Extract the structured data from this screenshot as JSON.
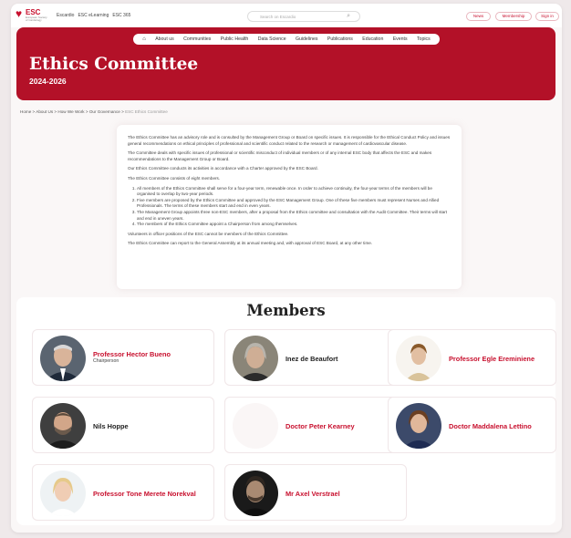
{
  "header": {
    "logo_text": "ESC",
    "logo_sub": "European Society of Cardiology",
    "links": [
      "Escardio",
      "ESC eLearning",
      "ESC 365"
    ],
    "search_placeholder": "Search on Escardio",
    "buttons": [
      "News",
      "Membership",
      "Sign in"
    ]
  },
  "nav": [
    "About us",
    "Communities",
    "Public Health",
    "Data Science",
    "Guidelines",
    "Publications",
    "Education",
    "Events",
    "Topics"
  ],
  "hero": {
    "title": "Ethics Committee",
    "years": "2024-2026"
  },
  "breadcrumb": [
    "Home",
    "About Us",
    "How We Work",
    "Our Governance",
    "ESC Ethics Committee"
  ],
  "content": {
    "p1": "The Ethics Committee has an advisory role and is consulted by the Management Group or Board on specific issues. It is responsible for the Ethical Conduct Policy and issues general recommendations on ethical principles of professional and scientific conduct related to the research or management of cardiovascular disease.",
    "p2": "The Committee deals with specific issues of professional or scientific misconduct of individual members or of any internal ESC body that affects the ESC and makes recommendations to the Management Group or Board.",
    "p3": "Our Ethics Committee conducts its activities in accordance with a Charter approved by the ESC Board.",
    "p4": "The Ethics Committee consists of eight members.",
    "list": [
      "All members of the Ethics Committee shall serve for a four-year term, renewable once. In order to achieve continuity, the four-year terms of the members will be organised to overlap by two-year periods.",
      "Five members are proposed by the Ethics Committee and approved by the ESC Management Group. One of these five members must represent Nurses and Allied Professionals. The terms of these members start and end in even years.",
      "The Management Group appoints three non-ESC members, after a proposal from the Ethics committee and consultation with the Audit Committee. Their terms will start and end in uneven years.",
      "The members of the Ethics Committee appoint a Chairperson from among themselves."
    ],
    "p5": "Volunteers in officer positions of the ESC cannot be members of the Ethics Committee.",
    "p6": "The Ethics Committee can report to the General Assembly at its annual meeting and, with approval of ESC Board, at any other time."
  },
  "members": {
    "title": "Members",
    "items": [
      {
        "name": "Professor Hector Bueno",
        "role": "Chairperson",
        "name_color": "red"
      },
      {
        "name": "Inez de Beaufort",
        "role": "",
        "name_color": "black"
      },
      {
        "name": "Professor Egle Ereminiene",
        "role": "",
        "name_color": "red"
      },
      {
        "name": "Nils Hoppe",
        "role": "",
        "name_color": "black"
      },
      {
        "name": "Doctor Peter Kearney",
        "role": "",
        "name_color": "red"
      },
      {
        "name": "Doctor Maddalena Lettino",
        "role": "",
        "name_color": "red"
      },
      {
        "name": "Professor Tone Merete Norekval",
        "role": "",
        "name_color": "red"
      },
      {
        "name": "Mr Axel Verstrael",
        "role": "",
        "name_color": "red"
      }
    ]
  },
  "colors": {
    "brand_red": "#c8102e",
    "hero_red": "#b31128",
    "background": "#efe9ea"
  }
}
